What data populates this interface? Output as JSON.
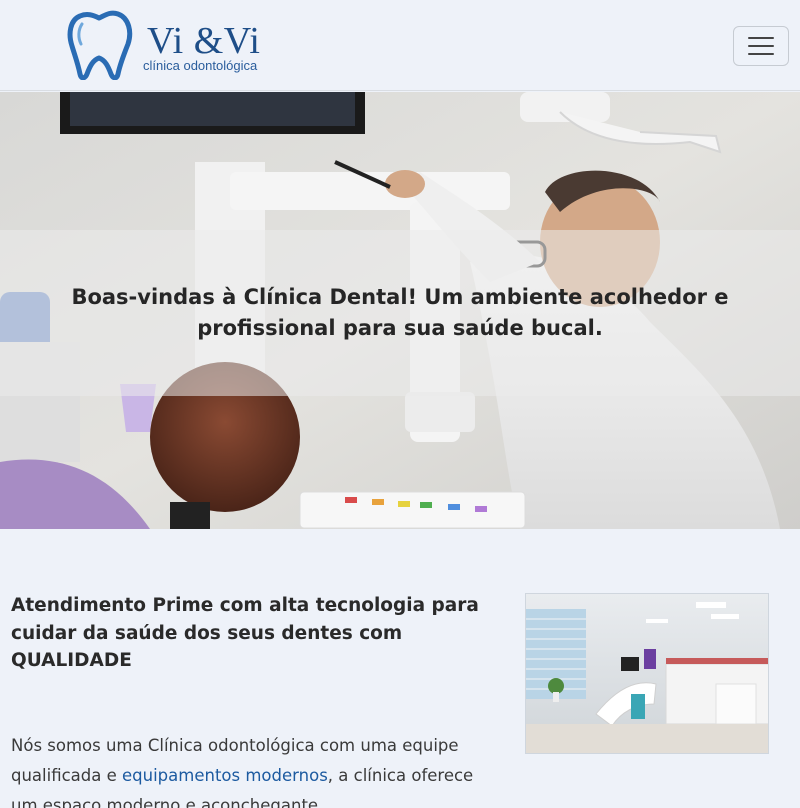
{
  "header": {
    "brand_name": "Vi &Vi",
    "brand_subtitle": "clínica odontológica",
    "menu_icon": "hamburger-menu-icon"
  },
  "hero": {
    "message": "Boas-vindas à Clínica Dental! Um ambiente acolhedor e profissional para sua saúde bucal.",
    "image": "dentist-with-patient-photo"
  },
  "intro": {
    "headline": "Atendimento Prime com alta tecnologia para cuidar da saúde dos seus dentes com QUALIDADE",
    "image": "clinic-room-photo",
    "paragraph_start": "Nós somos uma Clínica odontológica com uma equipe qualificada e ",
    "paragraph_link": "equipamentos modernos",
    "paragraph_end": ", a clínica oferece um espaço moderno e aconchegante"
  },
  "colors": {
    "brand_blue": "#1e4e88",
    "link_blue": "#1c5aa0",
    "background": "#eef2f9"
  }
}
